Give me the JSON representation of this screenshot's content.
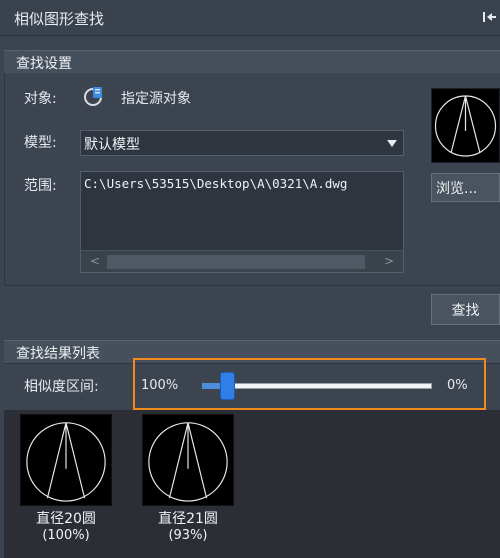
{
  "window": {
    "title": "相似图形查找",
    "pin_icon": "pin-icon"
  },
  "settings": {
    "header": "查找设置",
    "object_label": "对象:",
    "source_link": "指定源对象",
    "model_label": "模型:",
    "model_value": "默认模型",
    "range_label": "范围:",
    "range_path": "C:\\Users\\53515\\Desktop\\A\\0321\\A.dwg",
    "browse_label": "浏览...",
    "find_label": "查找"
  },
  "results": {
    "header": "查找结果列表",
    "similarity_label": "相似度区间:",
    "range_high": "100%",
    "range_low": "0%",
    "slider_value_percent": 88,
    "items": [
      {
        "name": "直径20圆",
        "score": "(100%)"
      },
      {
        "name": "直径21圆",
        "score": "(93%)"
      }
    ]
  },
  "colors": {
    "accent": "#f08a1c",
    "slider": "#2f7fe6",
    "background": "#3c4450"
  }
}
